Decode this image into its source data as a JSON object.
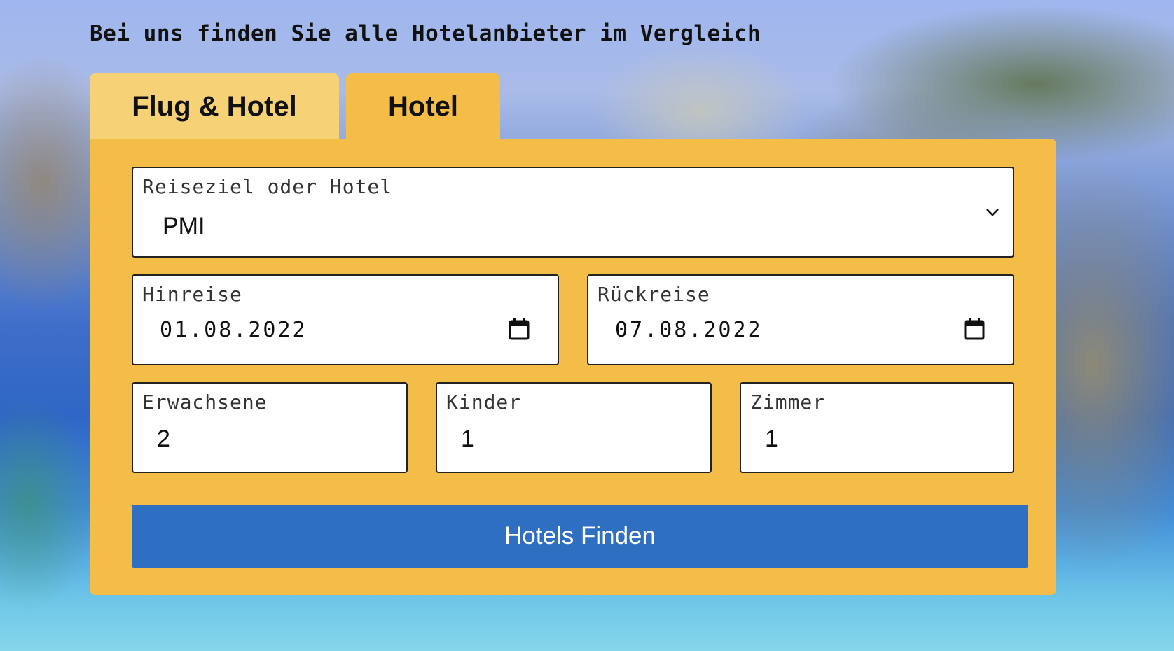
{
  "headline": "Bei uns finden Sie alle Hotelanbieter im Vergleich",
  "tabs": [
    {
      "label": "Flug & Hotel",
      "active": false
    },
    {
      "label": "Hotel",
      "active": true
    }
  ],
  "form": {
    "destination": {
      "label": "Reiseziel oder Hotel",
      "value": "PMI",
      "icon": "chevron-down-icon"
    },
    "departure": {
      "label": "Hinreise",
      "value": "01.08.2022",
      "icon": "calendar-icon"
    },
    "return": {
      "label": "Rückreise",
      "value": "07.08.2022",
      "icon": "calendar-icon"
    },
    "adults": {
      "label": "Erwachsene",
      "value": "2"
    },
    "children": {
      "label": "Kinder",
      "value": "1"
    },
    "rooms": {
      "label": "Zimmer",
      "value": "1"
    },
    "submit_label": "Hotels Finden"
  },
  "colors": {
    "panel": "#f3bd48",
    "inactive_tab": "#f6d176",
    "button": "#2f6fc1"
  }
}
